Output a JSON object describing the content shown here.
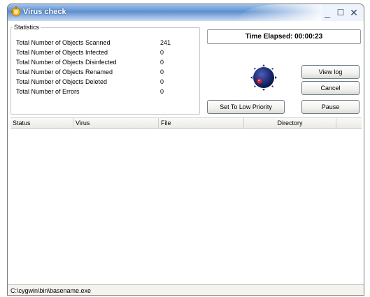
{
  "window": {
    "title": "Virus check",
    "icon": "virus-check-app-icon"
  },
  "statistics": {
    "legend": "Statistics",
    "rows": [
      {
        "label": "Total Number of Objects Scanned",
        "value": "241"
      },
      {
        "label": "Total Number of Objects Infected",
        "value": "0"
      },
      {
        "label": "Total Number of Objects Disinfected",
        "value": "0"
      },
      {
        "label": "Total Number of Objects Renamed",
        "value": "0"
      },
      {
        "label": "Total Number of Objects Deleted",
        "value": "0"
      },
      {
        "label": "Total Number of Errors",
        "value": "0"
      }
    ]
  },
  "time_elapsed": "Time Elapsed: 00:00:23",
  "buttons": {
    "view_log": "View log",
    "cancel": "Cancel",
    "low_priority": "Set To Low Priority",
    "pause": "Pause"
  },
  "list": {
    "columns": [
      "Status",
      "Virus",
      "File",
      "Directory",
      ""
    ],
    "rows": []
  },
  "status_bar": "C:\\cygwin\\bin\\basename.exe",
  "colors": {
    "title_bar": "#5e8fcf",
    "scan_ball": "#1f2f7a",
    "scan_ball_dot": "#d8202a"
  }
}
